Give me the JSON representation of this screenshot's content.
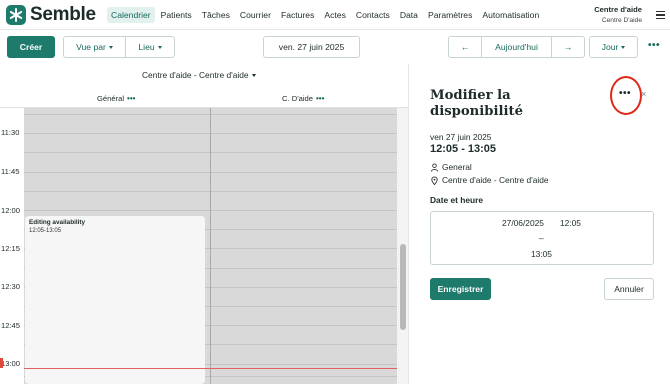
{
  "app": {
    "brand": "Semble"
  },
  "nav": {
    "items": [
      "Calendrier",
      "Patients",
      "Tâches",
      "Courrier",
      "Factures",
      "Actes",
      "Contacts",
      "Data",
      "Paramètres",
      "Automatisation"
    ]
  },
  "account": {
    "name": "Centre d'aide",
    "location": "Centre D'aide"
  },
  "toolbar": {
    "create": "Créer",
    "view_by": "Vue par",
    "place": "Lieu",
    "date": "ven. 27 juin 2025",
    "prev": "←",
    "today": "Aujourd'hui",
    "next": "→",
    "view_mode": "Jour",
    "more": "•••"
  },
  "calendar": {
    "location_header": "Centre d'aide - Centre d'aide",
    "columns": [
      {
        "label": "Général",
        "dots": "•••"
      },
      {
        "label": "C. D'aide",
        "dots": "•••"
      }
    ],
    "times": [
      "11:30",
      "11:45",
      "12:00",
      "12:15",
      "12:30",
      "12:45",
      "13:00"
    ],
    "event": {
      "title": "Editing availability",
      "time": "12:05-13:05"
    }
  },
  "panel": {
    "title": "Modifier la disponibilité",
    "more": "•••",
    "close": "×",
    "date": "ven 27 juin 2025",
    "time": "12:05 - 13:05",
    "staff": "General",
    "location": "Centre d'aide - Centre d'aide",
    "section": "Date et heure",
    "start_date": "27/06/2025",
    "start_time": "12:05",
    "separator": "–",
    "end_time": "13:05",
    "save": "Enregistrer",
    "cancel": "Annuler"
  },
  "colors": {
    "accent": "#1e7a6a",
    "highlight_circle": "#e02818",
    "now_line": "#e36161"
  }
}
